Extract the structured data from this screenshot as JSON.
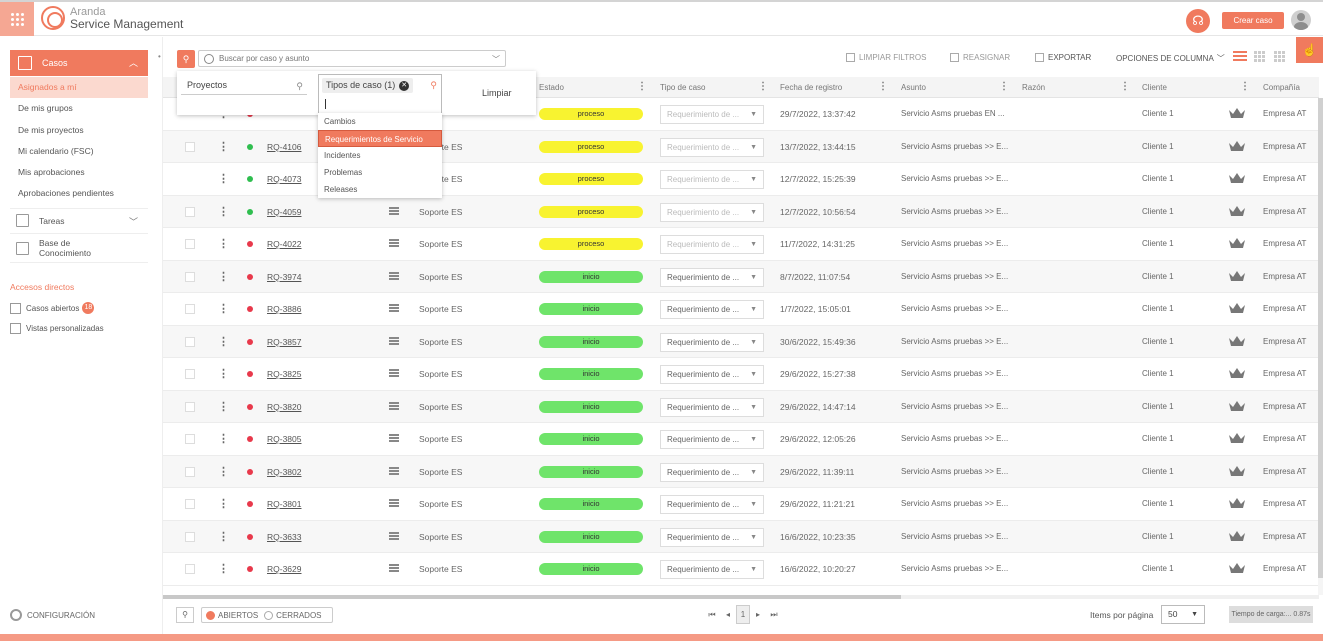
{
  "header": {
    "brand_line1": "Aranda",
    "brand_line2": "Service Management",
    "create_button": "Crear caso"
  },
  "sidebar": {
    "casos_label": "Casos",
    "items": [
      {
        "label": "Asignados a mí",
        "active": true
      },
      {
        "label": "De mis grupos"
      },
      {
        "label": "De mis proyectos"
      },
      {
        "label": "Mi calendario (FSC)"
      },
      {
        "label": "Mis aprobaciones"
      },
      {
        "label": "Aprobaciones pendientes"
      }
    ],
    "tareas_label": "Tareas",
    "base_label_1": "Base de",
    "base_label_2": "Conocimiento",
    "accesos_title": "Accesos directos",
    "casos_abiertos": "Casos abiertos",
    "casos_abiertos_count": "18",
    "vistas": "Vistas personalizadas",
    "config": "CONFIGURACIÓN"
  },
  "toolbar": {
    "search_placeholder": "Buscar por caso y asunto",
    "limpiar_filtros": "LIMPIAR FILTROS",
    "reasignar": "REASIGNAR",
    "exportar": "EXPORTAR",
    "opciones_columna": "OPCIONES DE COLUMNA"
  },
  "filter_popup": {
    "proyectos": "Proyectos",
    "tipos_tag": "Tipos de caso (1)",
    "limpiar": "Limpiar",
    "options": [
      {
        "label": "Cambios"
      },
      {
        "label": "Requerimientos de Servicio",
        "selected": true
      },
      {
        "label": "Incidentes"
      },
      {
        "label": "Problemas"
      },
      {
        "label": "Releases"
      }
    ]
  },
  "table": {
    "headers": {
      "estado": "Estado",
      "tipo": "Tipo de caso",
      "fecha": "Fecha de registro",
      "asunto": "Asunto",
      "razon": "Razón",
      "cliente": "Cliente",
      "compania": "Compañía"
    },
    "rows": [
      {
        "id": "",
        "dot": "red",
        "checkbox": false,
        "project": "",
        "status": "proceso",
        "type": "Requerimiento de ...",
        "type_disabled": true,
        "date": "29/7/2022, 13:37:42",
        "subject": "Servicio Asms pruebas EN ...",
        "client": "Cliente 1",
        "company": "Empresa AT"
      },
      {
        "id": "RQ-4106",
        "dot": "green",
        "checkbox": true,
        "project": "Soporte ES",
        "status": "proceso",
        "type": "Requerimiento de ...",
        "type_disabled": true,
        "date": "13/7/2022, 13:44:15",
        "subject": "Servicio Asms pruebas >> E...",
        "client": "Cliente 1",
        "company": "Empresa AT"
      },
      {
        "id": "RQ-4073",
        "dot": "green",
        "checkbox": false,
        "project": "Soporte ES",
        "status": "proceso",
        "type": "Requerimiento de ...",
        "type_disabled": true,
        "date": "12/7/2022, 15:25:39",
        "subject": "Servicio Asms pruebas >> E...",
        "client": "Cliente 1",
        "company": "Empresa AT"
      },
      {
        "id": "RQ-4059",
        "dot": "green",
        "checkbox": true,
        "project": "Soporte ES",
        "status": "proceso",
        "type": "Requerimiento de ...",
        "type_disabled": true,
        "date": "12/7/2022, 10:56:54",
        "subject": "Servicio Asms pruebas >> E...",
        "client": "Cliente 1",
        "company": "Empresa AT"
      },
      {
        "id": "RQ-4022",
        "dot": "red",
        "checkbox": true,
        "project": "Soporte ES",
        "status": "proceso",
        "type": "Requerimiento de ...",
        "type_disabled": true,
        "date": "11/7/2022, 14:31:25",
        "subject": "Servicio Asms pruebas >> E...",
        "client": "Cliente 1",
        "company": "Empresa AT"
      },
      {
        "id": "RQ-3974",
        "dot": "red",
        "checkbox": true,
        "project": "Soporte ES",
        "status": "inicio",
        "type": "Requerimiento de ...",
        "type_disabled": false,
        "date": "8/7/2022, 11:07:54",
        "subject": "Servicio Asms pruebas >> E...",
        "client": "Cliente 1",
        "company": "Empresa AT"
      },
      {
        "id": "RQ-3886",
        "dot": "red",
        "checkbox": true,
        "project": "Soporte ES",
        "status": "inicio",
        "type": "Requerimiento de ...",
        "type_disabled": false,
        "date": "1/7/2022, 15:05:01",
        "subject": "Servicio Asms pruebas >> E...",
        "client": "Cliente 1",
        "company": "Empresa AT"
      },
      {
        "id": "RQ-3857",
        "dot": "red",
        "checkbox": true,
        "project": "Soporte ES",
        "status": "inicio",
        "type": "Requerimiento de ...",
        "type_disabled": false,
        "date": "30/6/2022, 15:49:36",
        "subject": "Servicio Asms pruebas >> E...",
        "client": "Cliente 1",
        "company": "Empresa AT"
      },
      {
        "id": "RQ-3825",
        "dot": "red",
        "checkbox": true,
        "project": "Soporte ES",
        "status": "inicio",
        "type": "Requerimiento de ...",
        "type_disabled": false,
        "date": "29/6/2022, 15:27:38",
        "subject": "Servicio Asms pruebas >> E...",
        "client": "Cliente 1",
        "company": "Empresa AT"
      },
      {
        "id": "RQ-3820",
        "dot": "red",
        "checkbox": true,
        "project": "Soporte ES",
        "status": "inicio",
        "type": "Requerimiento de ...",
        "type_disabled": false,
        "date": "29/6/2022, 14:47:14",
        "subject": "Servicio Asms pruebas >> E...",
        "client": "Cliente 1",
        "company": "Empresa AT"
      },
      {
        "id": "RQ-3805",
        "dot": "red",
        "checkbox": true,
        "project": "Soporte ES",
        "status": "inicio",
        "type": "Requerimiento de ...",
        "type_disabled": false,
        "date": "29/6/2022, 12:05:26",
        "subject": "Servicio Asms pruebas >> E...",
        "client": "Cliente 1",
        "company": "Empresa AT"
      },
      {
        "id": "RQ-3802",
        "dot": "red",
        "checkbox": true,
        "project": "Soporte ES",
        "status": "inicio",
        "type": "Requerimiento de ...",
        "type_disabled": false,
        "date": "29/6/2022, 11:39:11",
        "subject": "Servicio Asms pruebas >> E...",
        "client": "Cliente 1",
        "company": "Empresa AT"
      },
      {
        "id": "RQ-3801",
        "dot": "red",
        "checkbox": true,
        "project": "Soporte ES",
        "status": "inicio",
        "type": "Requerimiento de ...",
        "type_disabled": false,
        "date": "29/6/2022, 11:21:21",
        "subject": "Servicio Asms pruebas >> E...",
        "client": "Cliente 1",
        "company": "Empresa AT"
      },
      {
        "id": "RQ-3633",
        "dot": "red",
        "checkbox": true,
        "project": "Soporte ES",
        "status": "inicio",
        "type": "Requerimiento de ...",
        "type_disabled": false,
        "date": "16/6/2022, 10:23:35",
        "subject": "Servicio Asms pruebas >> E...",
        "client": "Cliente 1",
        "company": "Empresa AT"
      },
      {
        "id": "RQ-3629",
        "dot": "red",
        "checkbox": true,
        "project": "Soporte ES",
        "status": "inicio",
        "type": "Requerimiento de ...",
        "type_disabled": false,
        "date": "16/6/2022, 10:20:27",
        "subject": "Servicio Asms pruebas >> E...",
        "client": "Cliente 1",
        "company": "Empresa AT"
      }
    ]
  },
  "footer": {
    "abiertos": "ABIERTOS",
    "cerrados": "CERRADOS",
    "page": "1",
    "items_label": "Items por página",
    "items_value": "50",
    "timer": "Tiempo de carga:... 0.87s"
  },
  "colors": {
    "accent": "#f07a5e",
    "proceso": "#f8f330",
    "inicio": "#6fe46a",
    "dot_red": "#e8394b",
    "dot_green": "#2fbe4f"
  }
}
